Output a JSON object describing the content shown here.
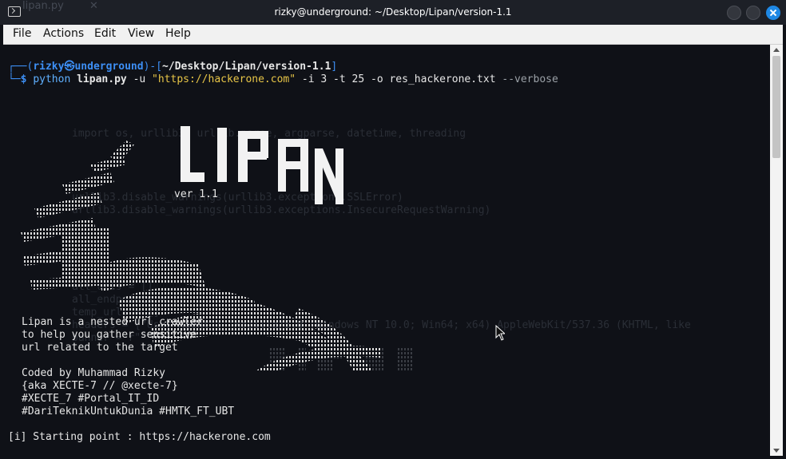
{
  "window": {
    "title": "rizky@underground: ~/Desktop/Lipan/version-1.1",
    "ghost_tab": "lipan.py",
    "ghost_tab_close": "✕"
  },
  "menu": {
    "file": "File",
    "actions": "Actions",
    "edit": "Edit",
    "view": "View",
    "help": "Help"
  },
  "prompt": {
    "open": "┌──(",
    "user": "rizky",
    "at": "㉿",
    "host": "underground",
    "mid": ")-[",
    "path": "~/Desktop/Lipan/version-1.1",
    "close": "]",
    "corner": "└─",
    "dollar": "$",
    "cmd": "python",
    "script": "lipan.py",
    "flag_u": "-u",
    "url_arg": "\"https://hackerone.com\"",
    "flag_i": "-i",
    "i_val": "3",
    "flag_t": "-t",
    "t_val": "25",
    "flag_o": "-o",
    "o_val": "res_hackerone.txt",
    "flag_v": "--verbose"
  },
  "banner": {
    "logo": "LIPAN",
    "version": "ver 1.1"
  },
  "info": {
    "desc1": "Lipan is a nested url crawler",
    "desc2": "to help you gather sensitive",
    "desc3": "url related to the target",
    "coded": "Coded by Muhammad Rizky",
    "aka": "{aka XECTE-7 // @xecte-7}",
    "tags1": "#XECTE_7 #Portal_IT_ID",
    "tags2": "#DariTeknikUntukDunia #HMTK_FT_UBT",
    "start": "[i] Starting point : https://hackerone.com"
  },
  "background_code": "\n\nimport os, urllib3, urllib.parse, argparse, datetime, threading\n\n\n\n\nurllib3.disable_warnings(urllib3.exceptions.SSLError)\nurllib3.disable_warnings(urllib3.exceptions.InsecureRequestWarning)\n\n\n\n\n\nall_urls = []\nall_endpoints = []\ntemp_urls = []\nheaders = {\"User-Agent\": \"Mozilla/5.0 (Windows NT 10.0; Win64; x64) AppleWebKit/537.36 (KHTML, like\nbanner = r\"\"\""
}
